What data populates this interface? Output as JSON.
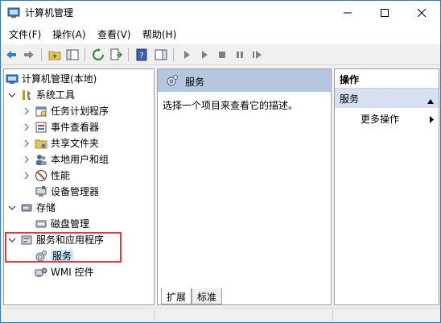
{
  "window": {
    "title": "计算机管理"
  },
  "menu": [
    {
      "label": "文件(F)"
    },
    {
      "label": "操作(A)"
    },
    {
      "label": "查看(V)"
    },
    {
      "label": "帮助(H)"
    }
  ],
  "tree": {
    "root": "计算机管理(本地)",
    "items": [
      {
        "label": "系统工具"
      },
      {
        "label": "任务计划程序"
      },
      {
        "label": "事件查看器"
      },
      {
        "label": "共享文件夹"
      },
      {
        "label": "本地用户和组"
      },
      {
        "label": "性能"
      },
      {
        "label": "设备管理器"
      },
      {
        "label": "存储"
      },
      {
        "label": "磁盘管理"
      },
      {
        "label": "服务和应用程序"
      },
      {
        "label": "服务"
      },
      {
        "label": "WMI 控件"
      }
    ]
  },
  "center": {
    "title": "服务",
    "description": "选择一个项目来查看它的描述。",
    "tabs": [
      "扩展",
      "标准"
    ]
  },
  "actions": {
    "header": "操作",
    "section": "服务",
    "more": "更多操作"
  },
  "colors": {
    "accent": "#2b78d4",
    "selection": "#cce8ff",
    "center_header": "#b5c7de",
    "actions_section": "#d5e1f2",
    "highlight": "#e0393e"
  }
}
